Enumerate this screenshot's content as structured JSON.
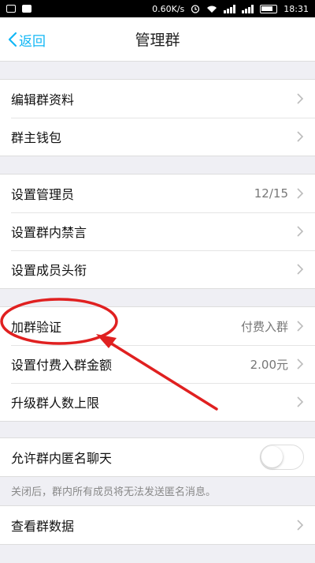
{
  "status_bar": {
    "speed": "0.60K/s",
    "time": "18:31"
  },
  "nav": {
    "back_label": "返回",
    "title": "管理群"
  },
  "groups": {
    "group1": [
      {
        "label": "编辑群资料"
      },
      {
        "label": "群主钱包"
      }
    ],
    "group2": [
      {
        "label": "设置管理员",
        "value": "12/15"
      },
      {
        "label": "设置群内禁言"
      },
      {
        "label": "设置成员头衔"
      }
    ],
    "group3": [
      {
        "label": "加群验证",
        "value": "付费入群"
      },
      {
        "label": "设置付费入群金额",
        "value": "2.00元"
      },
      {
        "label": "升级群人数上限"
      }
    ],
    "group4": [
      {
        "label": "允许群内匿名聊天",
        "toggle_on": false
      }
    ],
    "group4_note": "关闭后，群内所有成员将无法发送匿名消息。",
    "group5": [
      {
        "label": "查看群数据"
      }
    ]
  },
  "colors": {
    "accent": "#12b7f5",
    "annotation": "#e02020"
  }
}
